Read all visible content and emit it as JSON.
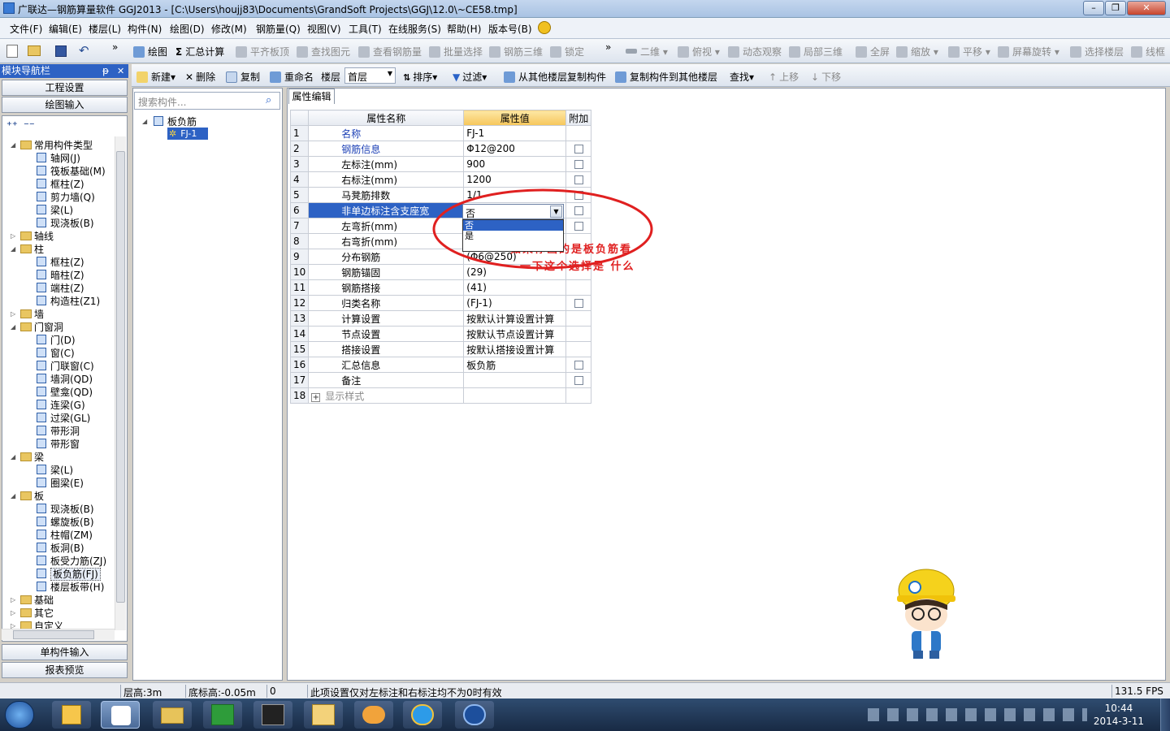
{
  "window": {
    "title": "广联达—钢筋算量软件 GGJ2013 - [C:\\Users\\houjj83\\Documents\\GrandSoft Projects\\GGJ\\12.0\\~CE58.tmp]"
  },
  "menu": [
    "文件(F)",
    "编辑(E)",
    "楼层(L)",
    "构件(N)",
    "绘图(D)",
    "修改(M)",
    "钢筋量(Q)",
    "视图(V)",
    "工具(T)",
    "在线服务(S)",
    "帮助(H)",
    "版本号(B)"
  ],
  "toolbar1": [
    {
      "label": "绘图",
      "enabled": true
    },
    {
      "label": "汇总计算",
      "enabled": true
    },
    {
      "label": "平齐板顶",
      "enabled": false
    },
    {
      "label": "查找图元",
      "enabled": false
    },
    {
      "label": "查看钢筋量",
      "enabled": false
    },
    {
      "label": "批量选择",
      "enabled": false
    },
    {
      "label": "钢筋三维",
      "enabled": false
    },
    {
      "label": "锁定",
      "enabled": false
    },
    {
      "label": "二维",
      "enabled": false
    },
    {
      "label": "俯视",
      "enabled": false
    },
    {
      "label": "动态观察",
      "enabled": false
    },
    {
      "label": "局部三维",
      "enabled": false
    },
    {
      "label": "全屏",
      "enabled": false
    },
    {
      "label": "缩放",
      "enabled": false
    },
    {
      "label": "平移",
      "enabled": false
    },
    {
      "label": "屏幕旋转",
      "enabled": false
    },
    {
      "label": "选择楼层",
      "enabled": false
    },
    {
      "label": "线框",
      "enabled": false
    }
  ],
  "toolbar2": {
    "new": "新建",
    "delete": "删除",
    "copy": "复制",
    "rename": "重命名",
    "floor_label": "楼层",
    "floor_value": "首层",
    "sort": "排序",
    "filter": "过滤",
    "copy_from": "从其他楼层复制构件",
    "copy_to": "复制构件到其他楼层",
    "find": "查找",
    "move_up": "上移",
    "move_down": "下移"
  },
  "nav": {
    "title": "模块导航栏",
    "pin": "ꟼ",
    "project_settings": "工程设置",
    "drawing_input": "绘图输入",
    "single_input": "单构件输入",
    "report": "报表预览",
    "tree": [
      {
        "label": "常用构件类型",
        "level": 0,
        "type": "folder",
        "open": true
      },
      {
        "label": "轴网(J)",
        "level": 1
      },
      {
        "label": "筏板基础(M)",
        "level": 1
      },
      {
        "label": "框柱(Z)",
        "level": 1
      },
      {
        "label": "剪力墙(Q)",
        "level": 1
      },
      {
        "label": "梁(L)",
        "level": 1
      },
      {
        "label": "现浇板(B)",
        "level": 1
      },
      {
        "label": "轴线",
        "level": 0,
        "type": "folder",
        "open": false
      },
      {
        "label": "柱",
        "level": 0,
        "type": "folder",
        "open": true
      },
      {
        "label": "框柱(Z)",
        "level": 1
      },
      {
        "label": "暗柱(Z)",
        "level": 1
      },
      {
        "label": "端柱(Z)",
        "level": 1
      },
      {
        "label": "构造柱(Z1)",
        "level": 1
      },
      {
        "label": "墙",
        "level": 0,
        "type": "folder",
        "open": false
      },
      {
        "label": "门窗洞",
        "level": 0,
        "type": "folder",
        "open": true
      },
      {
        "label": "门(D)",
        "level": 1
      },
      {
        "label": "窗(C)",
        "level": 1
      },
      {
        "label": "门联窗(C)",
        "level": 1
      },
      {
        "label": "墙洞(QD)",
        "level": 1
      },
      {
        "label": "壁龛(QD)",
        "level": 1
      },
      {
        "label": "连梁(G)",
        "level": 1
      },
      {
        "label": "过梁(GL)",
        "level": 1
      },
      {
        "label": "带形洞",
        "level": 1
      },
      {
        "label": "带形窗",
        "level": 1
      },
      {
        "label": "梁",
        "level": 0,
        "type": "folder",
        "open": true
      },
      {
        "label": "梁(L)",
        "level": 1
      },
      {
        "label": "圈梁(E)",
        "level": 1
      },
      {
        "label": "板",
        "level": 0,
        "type": "folder",
        "open": true
      },
      {
        "label": "现浇板(B)",
        "level": 1
      },
      {
        "label": "螺旋板(B)",
        "level": 1
      },
      {
        "label": "柱帽(ZM)",
        "level": 1
      },
      {
        "label": "板洞(B)",
        "level": 1
      },
      {
        "label": "板受力筋(ZJ)",
        "level": 1
      },
      {
        "label": "板负筋(FJ)",
        "level": 1,
        "selected": true
      },
      {
        "label": "楼层板带(H)",
        "level": 1
      },
      {
        "label": "基础",
        "level": 0,
        "type": "folder",
        "open": false
      },
      {
        "label": "其它",
        "level": 0,
        "type": "folder",
        "open": false
      },
      {
        "label": "自定义",
        "level": 0,
        "type": "folder",
        "open": false
      }
    ]
  },
  "component_list": {
    "search_placeholder": "搜索构件...",
    "root": "板负筋",
    "child": "FJ-1"
  },
  "prop_editor": {
    "tab": "属性编辑",
    "headers": [
      "属性名称",
      "属性值",
      "附加"
    ],
    "rows": [
      {
        "n": "1",
        "name": "名称",
        "value": "FJ-1",
        "blue": true,
        "cb": false
      },
      {
        "n": "2",
        "name": "钢筋信息",
        "value": "Φ12@200",
        "blue": true,
        "cb": true
      },
      {
        "n": "3",
        "name": "左标注(mm)",
        "value": "900",
        "blue": false,
        "cb": true
      },
      {
        "n": "4",
        "name": "右标注(mm)",
        "value": "1200",
        "blue": false,
        "cb": true
      },
      {
        "n": "5",
        "name": "马凳筋排数",
        "value": "1/1",
        "blue": false,
        "cb": true
      },
      {
        "n": "6",
        "name": "非单边标注含支座宽",
        "value": "",
        "blue": false,
        "cb": true,
        "selected": true
      },
      {
        "n": "7",
        "name": "左弯折(mm)",
        "value": "",
        "blue": false,
        "cb": true
      },
      {
        "n": "8",
        "name": "右弯折(mm)",
        "value": "(0)",
        "blue": false,
        "cb": false
      },
      {
        "n": "9",
        "name": "分布钢筋",
        "value": "(Φ6@250)",
        "blue": false,
        "cb": false
      },
      {
        "n": "10",
        "name": "钢筋锚固",
        "value": "(29)",
        "blue": false,
        "cb": false
      },
      {
        "n": "11",
        "name": "钢筋搭接",
        "value": "(41)",
        "blue": false,
        "cb": false
      },
      {
        "n": "12",
        "name": "归类名称",
        "value": "(FJ-1)",
        "blue": false,
        "cb": true
      },
      {
        "n": "13",
        "name": "计算设置",
        "value": "按默认计算设置计算",
        "blue": false,
        "cb": false
      },
      {
        "n": "14",
        "name": "节点设置",
        "value": "按默认节点设置计算",
        "blue": false,
        "cb": false
      },
      {
        "n": "15",
        "name": "搭接设置",
        "value": "按默认搭接设置计算",
        "blue": false,
        "cb": false
      },
      {
        "n": "16",
        "name": "汇总信息",
        "value": "板负筋",
        "blue": false,
        "cb": true
      },
      {
        "n": "17",
        "name": "备注",
        "value": "",
        "blue": false,
        "cb": true
      },
      {
        "n": "18",
        "name": "显示样式",
        "value": "",
        "blue": false,
        "cb": false,
        "expander": "+"
      }
    ],
    "dropdown": {
      "current": "否",
      "options": [
        "否",
        "是"
      ]
    }
  },
  "annotation": {
    "line1": "如果你画的是板负筋看",
    "line2": "一下这个选择是 什么"
  },
  "status": {
    "floor_height": "层高:3m",
    "bottom_elev": "底标高:-0.05m",
    "value": "0",
    "message": "此项设置仅对左标注和右标注均不为0时有效",
    "fps": "131.5 FPS"
  },
  "clock": {
    "time": "10:44",
    "date": "2014-3-11"
  },
  "colors": {
    "accent": "#2d62c4",
    "header_highlight": "#f6c65a",
    "annotation": "#e02020"
  }
}
